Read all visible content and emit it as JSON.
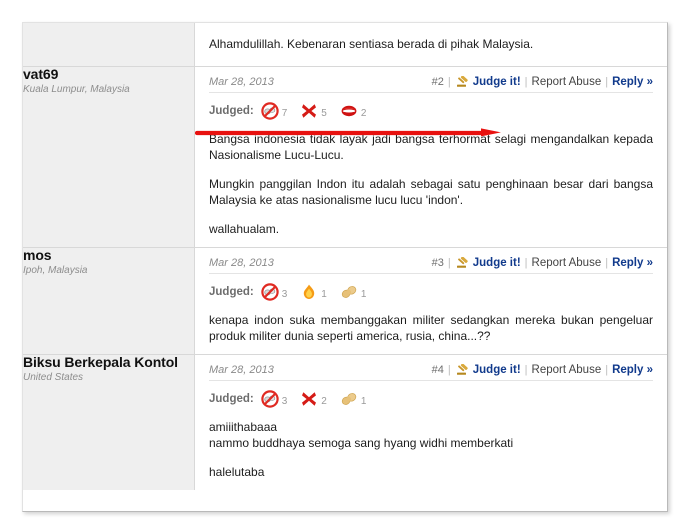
{
  "quote": {
    "text": "Alhamdulillah. Kebenaran sentiasa berada di pihak Malaysia."
  },
  "labels": {
    "judged": "Judged:",
    "judge_it": "Judge it!",
    "report_abuse": "Report Abuse",
    "reply": "Reply »",
    "separator": "|",
    "gavel_icon": "gavel-icon"
  },
  "colors": {
    "link_blue": "#113a8c",
    "report_gray": "#444444",
    "sidebar_bg": "#efefef",
    "annotation_red": "#e8110f",
    "judged_label": "#6d6d6d"
  },
  "posts": [
    {
      "username": "vat69",
      "location": "Kuala Lumpur, Malaysia",
      "date": "Mar 28, 2013",
      "number": "#2",
      "judged": [
        {
          "icon": "no-bullshit-icon",
          "count": "7"
        },
        {
          "icon": "red-x-icon",
          "count": "5"
        },
        {
          "icon": "lips-icon",
          "count": "2"
        }
      ],
      "paragraphs": [
        "Bangsa indonesia tidak layak jadi bangsa terhormat selagi mengandalkan kepada Nasionalisme Lucu-Lucu.",
        "Mungkin panggilan Indon itu adalah sebagai satu penghinaan besar dari bangsa Malaysia ke atas nasionalisme lucu lucu 'indon'.",
        "wallahualam."
      ],
      "annotated": true
    },
    {
      "username": "mos",
      "location": "Ipoh, Malaysia",
      "date": "Mar 28, 2013",
      "number": "#3",
      "judged": [
        {
          "icon": "no-bullshit-icon",
          "count": "3"
        },
        {
          "icon": "flame-icon",
          "count": "1"
        },
        {
          "icon": "peanut-icon",
          "count": "1"
        }
      ],
      "paragraphs": [
        "kenapa indon suka membanggakan militer sedangkan mereka bukan pengeluar produk militer dunia seperti america, rusia, china...??"
      ],
      "annotated": false
    },
    {
      "username": "Biksu Berkepala Kontol",
      "location": "United States",
      "date": "Mar 28, 2013",
      "number": "#4",
      "judged": [
        {
          "icon": "no-bullshit-icon",
          "count": "3"
        },
        {
          "icon": "red-x-icon",
          "count": "2"
        },
        {
          "icon": "peanut-icon",
          "count": "1"
        }
      ],
      "paragraphs": [
        "amiiithabaaa",
        "nammo buddhaya semoga sang hyang widhi memberkati",
        "halelutaba"
      ],
      "annotated": false
    }
  ]
}
